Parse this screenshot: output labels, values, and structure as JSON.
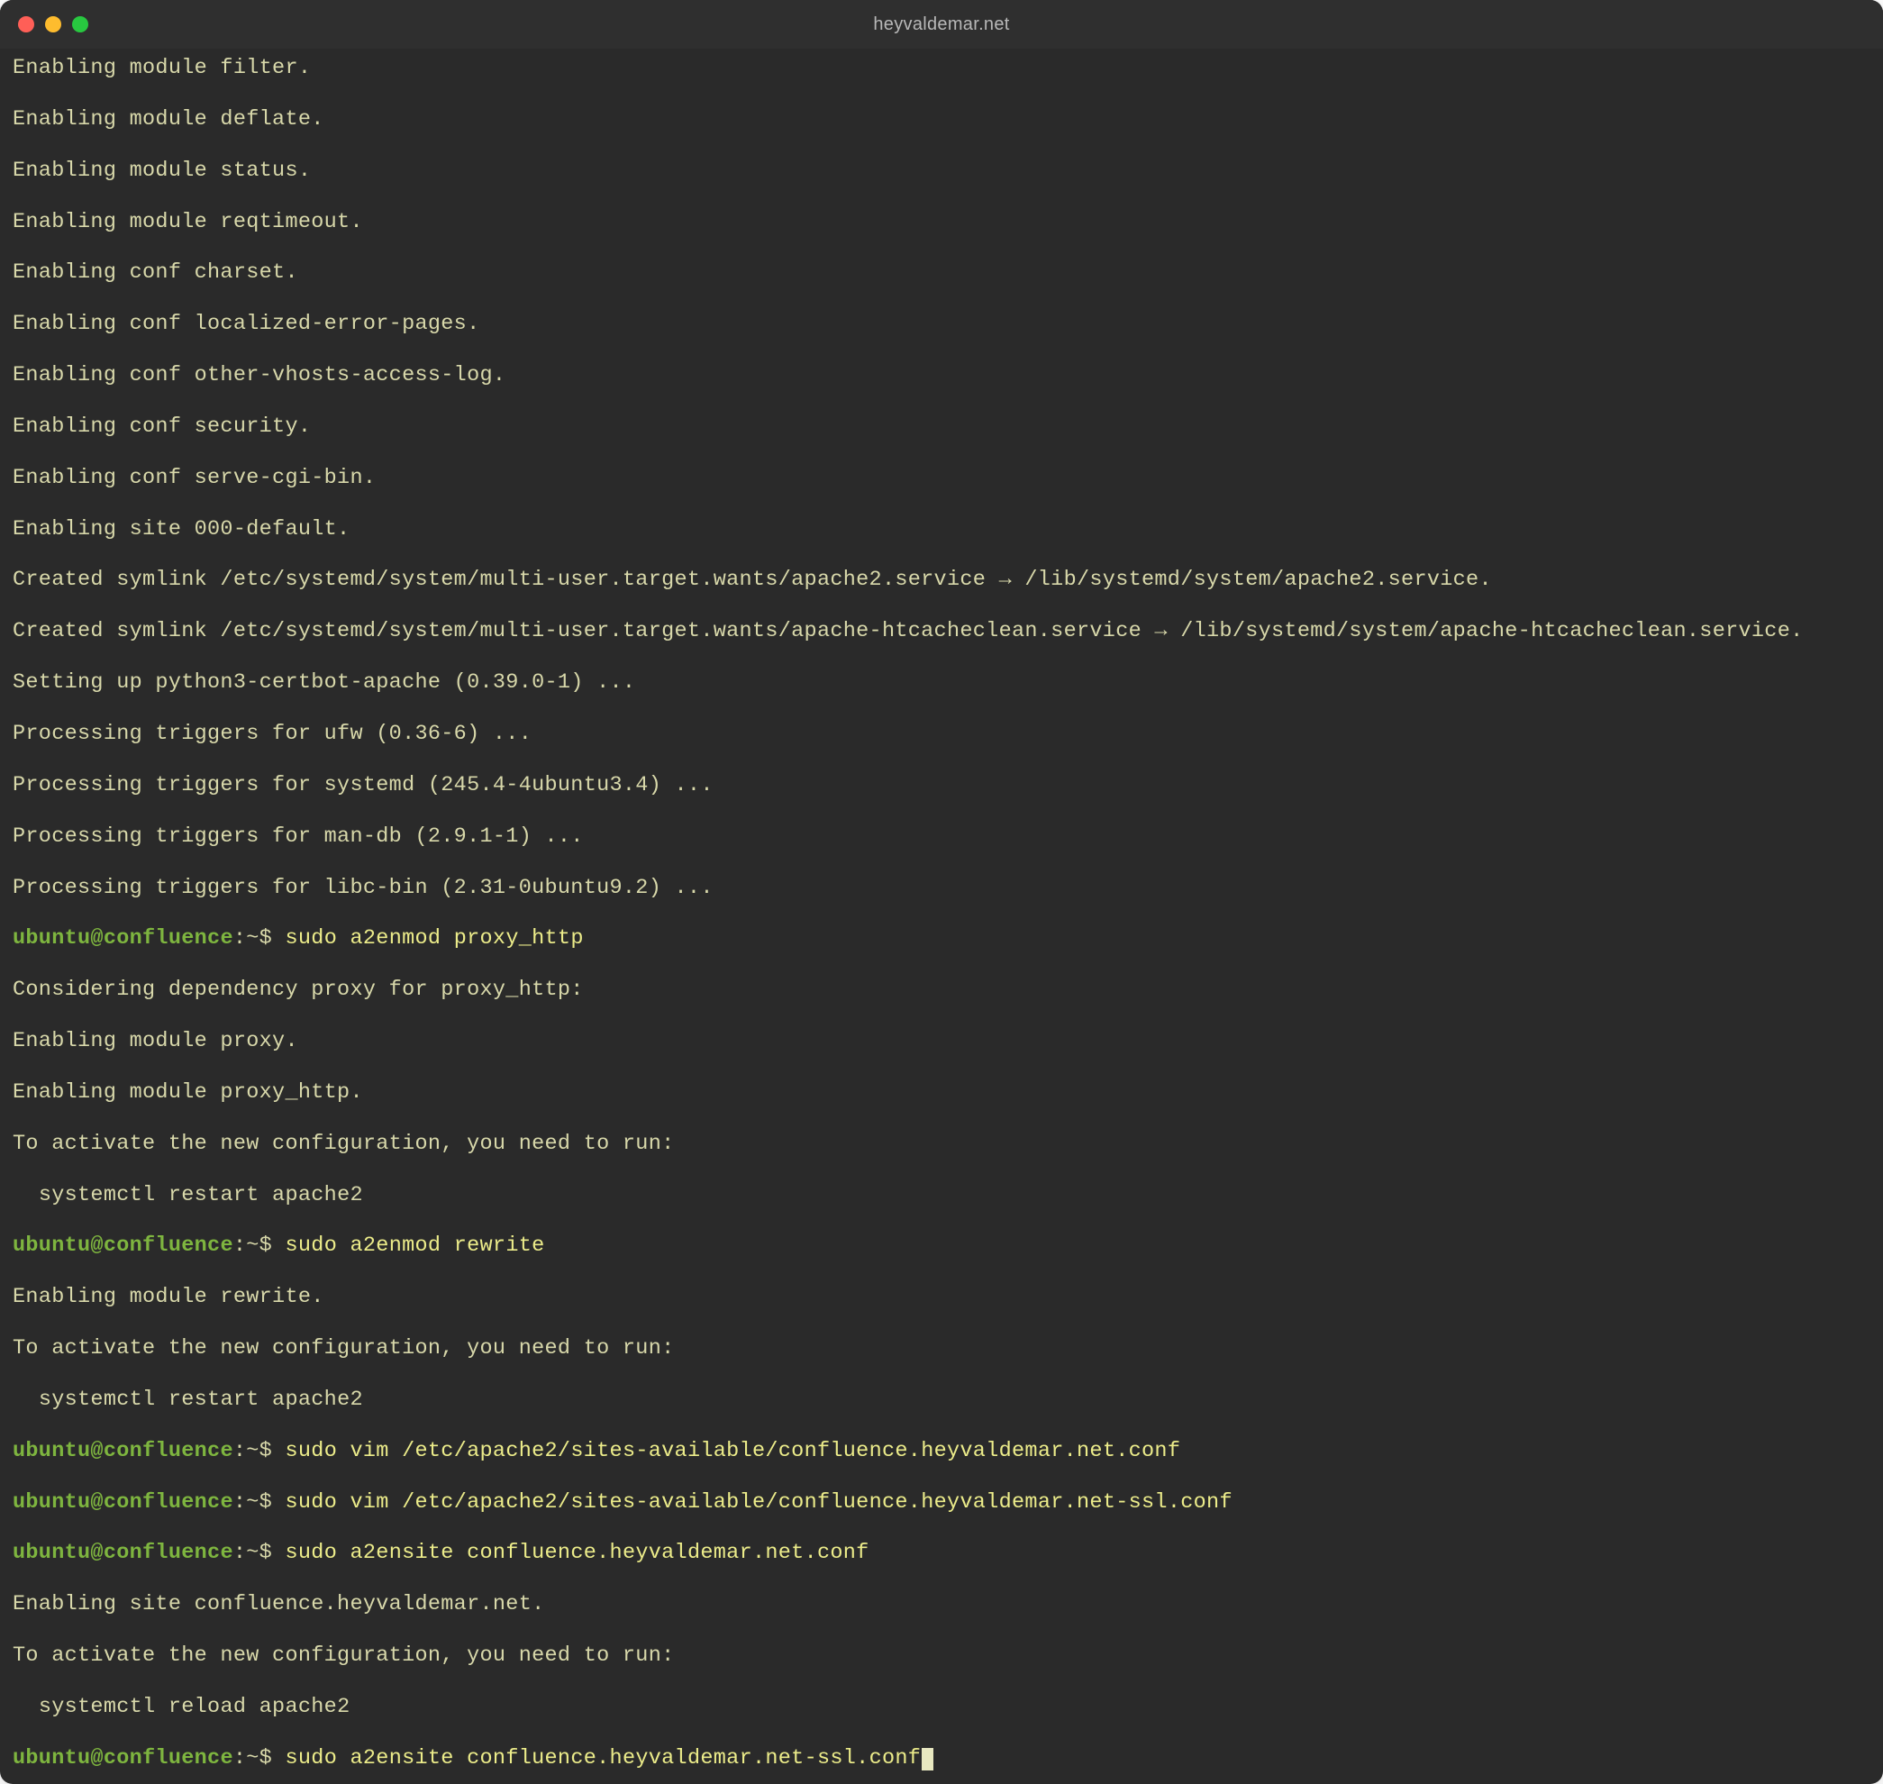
{
  "window": {
    "title": "heyvaldemar.net"
  },
  "prompt": {
    "user": "ubuntu",
    "host": "confluence",
    "path": "~",
    "symbol": "$"
  },
  "lines": {
    "l1": "Enabling module filter.",
    "l2": "Enabling module deflate.",
    "l3": "Enabling module status.",
    "l4": "Enabling module reqtimeout.",
    "l5": "Enabling conf charset.",
    "l6": "Enabling conf localized-error-pages.",
    "l7": "Enabling conf other-vhosts-access-log.",
    "l8": "Enabling conf security.",
    "l9": "Enabling conf serve-cgi-bin.",
    "l10": "Enabling site 000-default.",
    "l11": "Created symlink /etc/systemd/system/multi-user.target.wants/apache2.service → /lib/systemd/system/apache2.service.",
    "l12": "Created symlink /etc/systemd/system/multi-user.target.wants/apache-htcacheclean.service → /lib/systemd/system/apache-htcacheclean.service.",
    "l13": "Setting up python3-certbot-apache (0.39.0-1) ...",
    "l14": "Processing triggers for ufw (0.36-6) ...",
    "l15": "Processing triggers for systemd (245.4-4ubuntu3.4) ...",
    "l16": "Processing triggers for man-db (2.9.1-1) ...",
    "l17": "Processing triggers for libc-bin (2.31-0ubuntu9.2) ...",
    "cmd1": "sudo a2enmod proxy_http",
    "l18": "Considering dependency proxy for proxy_http:",
    "l19": "Enabling module proxy.",
    "l20": "Enabling module proxy_http.",
    "l21": "To activate the new configuration, you need to run:",
    "l22": "  systemctl restart apache2",
    "cmd2": "sudo a2enmod rewrite",
    "l23": "Enabling module rewrite.",
    "l24": "To activate the new configuration, you need to run:",
    "l25": "  systemctl restart apache2",
    "cmd3": "sudo vim /etc/apache2/sites-available/confluence.heyvaldemar.net.conf",
    "cmd4": "sudo vim /etc/apache2/sites-available/confluence.heyvaldemar.net-ssl.conf",
    "cmd5": "sudo a2ensite confluence.heyvaldemar.net.conf",
    "l26": "Enabling site confluence.heyvaldemar.net.",
    "l27": "To activate the new configuration, you need to run:",
    "l28": "  systemctl reload apache2",
    "cmd6": "sudo a2ensite confluence.heyvaldemar.net-ssl.conf"
  }
}
